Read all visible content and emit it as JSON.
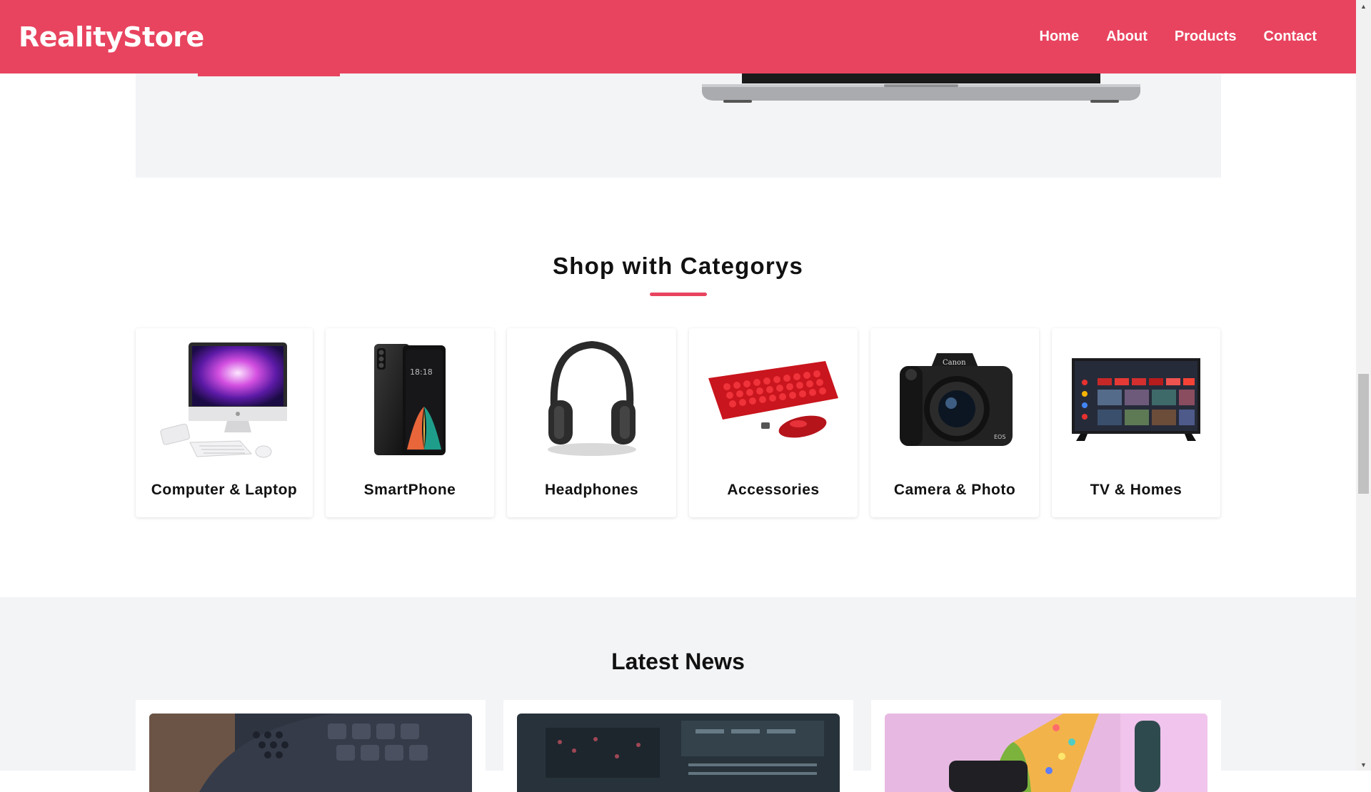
{
  "header": {
    "brand": "RealityStore",
    "nav": [
      "Home",
      "About",
      "Products",
      "Contact"
    ],
    "accent_color": "#e8445f"
  },
  "categories": {
    "title": "Shop with Categorys",
    "items": [
      {
        "label": "Computer & Laptop",
        "icon": "desktop-computer-icon"
      },
      {
        "label": "SmartPhone",
        "icon": "smartphone-icon"
      },
      {
        "label": "Headphones",
        "icon": "headphones-icon"
      },
      {
        "label": "Accessories",
        "icon": "keyboard-mouse-icon"
      },
      {
        "label": "Camera & Photo",
        "icon": "camera-icon"
      },
      {
        "label": "TV & Homes",
        "icon": "television-icon"
      }
    ]
  },
  "news": {
    "title": "Latest News"
  }
}
